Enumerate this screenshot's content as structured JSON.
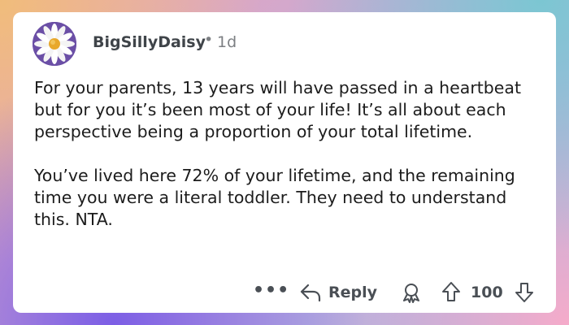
{
  "comment": {
    "author": "BigSillyDaisy",
    "separator": "•",
    "age": "1d",
    "avatar_icon": "daisy-avatar",
    "paragraphs": [
      "For your parents, 13 years will have passed in a heartbeat but for you it’s been most of your life! It’s all about each perspective being a proportion of your total lifetime.",
      "You’ve lived here 72% of your lifetime, and the remaining time you were a literal toddler. They need to understand this. NTA."
    ]
  },
  "actions": {
    "more_label": "•••",
    "reply_label": "Reply",
    "score": "100",
    "icons": [
      "reply-arrow-icon",
      "award-icon",
      "upvote-arrow-icon",
      "downvote-arrow-icon"
    ]
  },
  "colors": {
    "avatar_bg": "#6b4fa6",
    "text": "#1c1c1c",
    "meta": "#7c7f83",
    "action": "#4a4f55"
  }
}
